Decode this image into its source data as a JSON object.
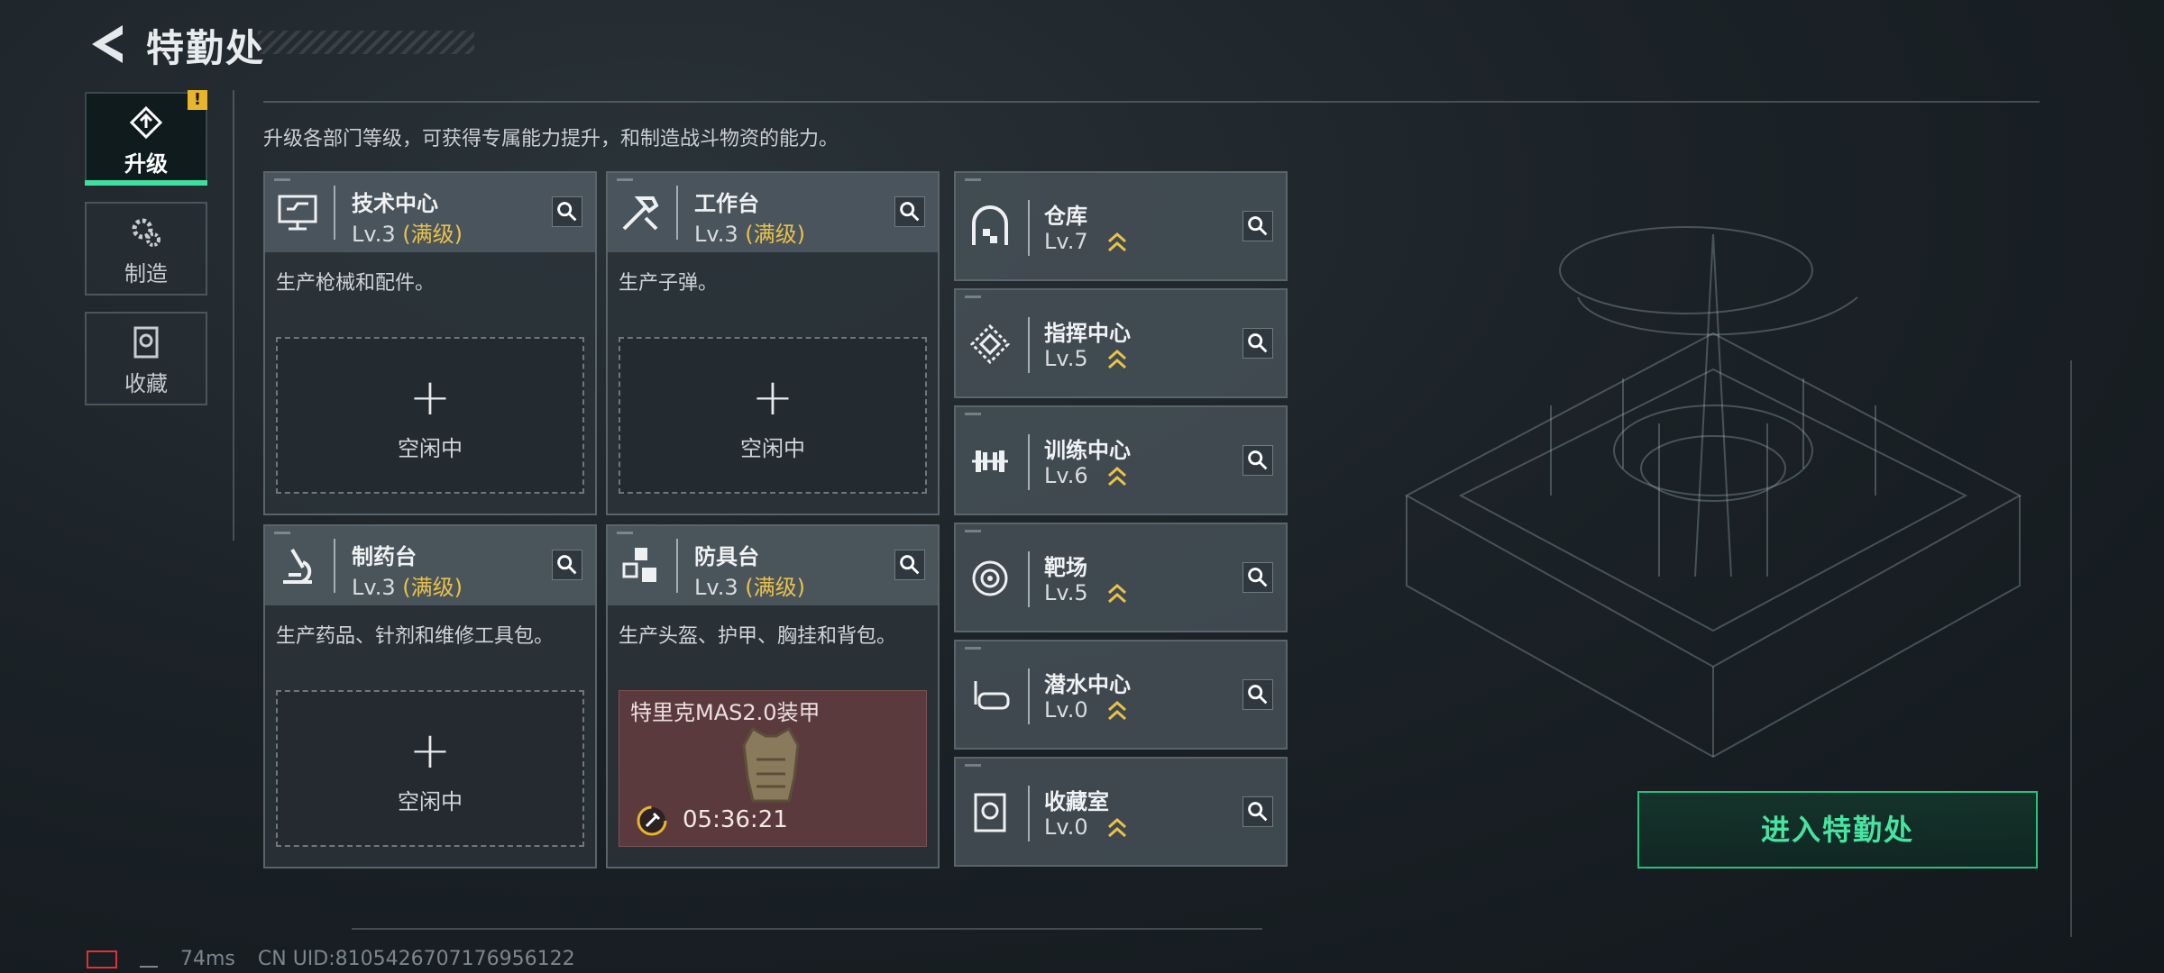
{
  "header": {
    "title": "特勤处"
  },
  "nav": [
    {
      "label": "升级",
      "icon": "upgrade-icon",
      "active": true
    },
    {
      "label": "制造",
      "icon": "gears-icon",
      "active": false
    },
    {
      "label": "收藏",
      "icon": "collection-icon",
      "active": false
    }
  ],
  "nav_warning": "!",
  "description": "升级各部门等级，可获得专属能力提升，和制造战斗物资的能力。",
  "departments": [
    {
      "name": "技术中心",
      "level": "Lv.3",
      "max": "(满级)",
      "desc": "生产枪械和配件。",
      "status": "空闲中"
    },
    {
      "name": "工作台",
      "level": "Lv.3",
      "max": "(满级)",
      "desc": "生产子弹。",
      "status": "空闲中"
    },
    {
      "name": "制药台",
      "level": "Lv.3",
      "max": "(满级)",
      "desc": "生产药品、针剂和维修工具包。",
      "status": "空闲中"
    },
    {
      "name": "防具台",
      "level": "Lv.3",
      "max": "(满级)",
      "desc": "生产头盔、护甲、胸挂和背包。",
      "craft_item": "特里克MAS2.0装甲",
      "craft_timer": "05:36:21"
    }
  ],
  "facilities": [
    {
      "name": "仓库",
      "level": "Lv.7",
      "icon": "warehouse-icon"
    },
    {
      "name": "指挥中心",
      "level": "Lv.5",
      "icon": "command-center-icon"
    },
    {
      "name": "训练中心",
      "level": "Lv.6",
      "icon": "dumbbell-icon"
    },
    {
      "name": "靶场",
      "level": "Lv.5",
      "icon": "target-icon"
    },
    {
      "name": "潜水中心",
      "level": "Lv.0",
      "icon": "diving-mask-icon"
    },
    {
      "name": "收藏室",
      "level": "Lv.0",
      "icon": "collection-room-icon"
    }
  ],
  "enter_button": "进入特勤处",
  "footer": {
    "ping": "74ms",
    "uid": "CN UID:8105426707176956122"
  },
  "colors": {
    "accent": "#3ee0a0",
    "max_level": "#e9c24a",
    "warning": "#e8b52c",
    "crafting_bg": "#5a3a3d"
  }
}
